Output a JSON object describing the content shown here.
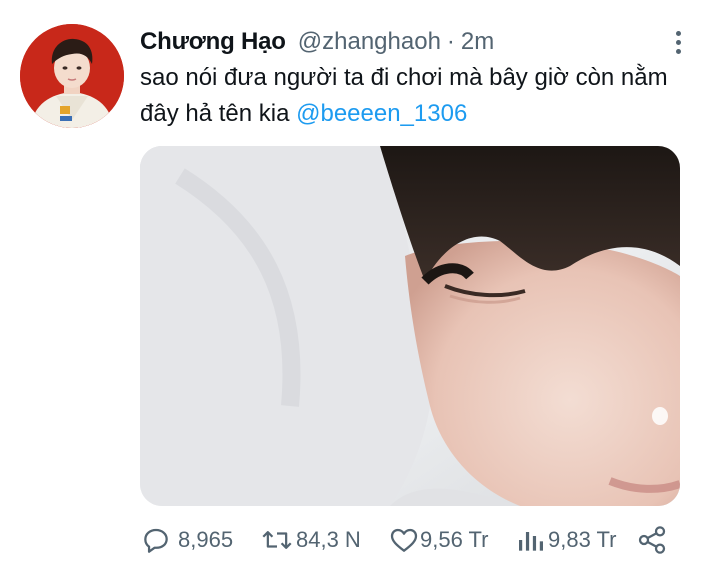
{
  "tweet": {
    "display_name": "Chương Hạo",
    "handle": "@zhanghaoh",
    "separator": "·",
    "time": "2m",
    "text": "sao nói đưa người ta đi chơi mà bây giờ còn nằm đây hả tên kia",
    "mention": "@beeeen_1306"
  },
  "actions": {
    "replies": "8,965",
    "retweets": "84,3 N",
    "likes": "9,56 Tr",
    "views": "9,83 Tr"
  },
  "icons": {
    "more": "more-vertical-icon",
    "reply": "reply-icon",
    "retweet": "retweet-icon",
    "like": "heart-icon",
    "views": "views-icon",
    "share": "share-icon"
  },
  "colors": {
    "text": "#0f1419",
    "secondary": "#536471",
    "link": "#1d9bf0"
  }
}
